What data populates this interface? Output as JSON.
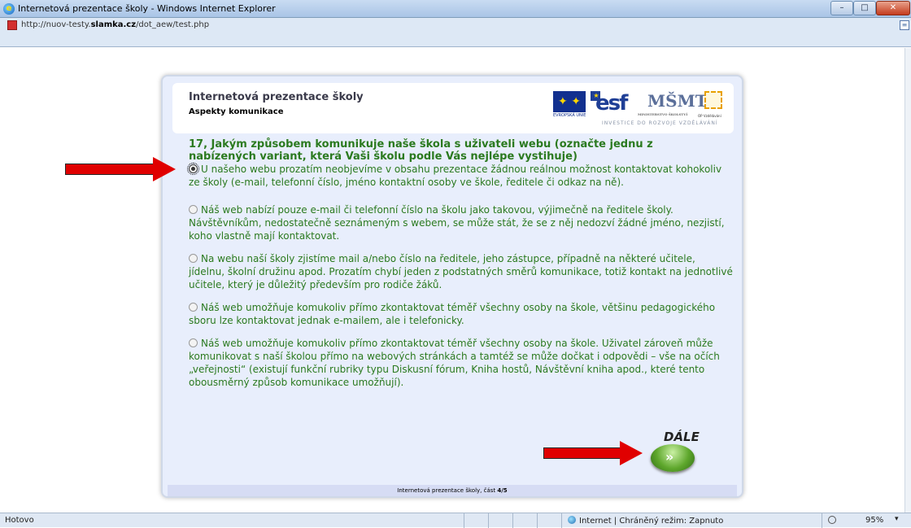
{
  "window": {
    "title": "Internetová prezentace školy - Windows Internet Explorer",
    "minimize": "–",
    "maximize": "□",
    "close": "✕"
  },
  "address": {
    "url_prefix": "http://nuov-testy.",
    "url_domain": "slamka.cz",
    "url_path": "/dot_aew/test.php"
  },
  "page": {
    "title": "Internetová prezentace školy",
    "subtitle": "Aspekty komunikace",
    "logo_tagline": "INVESTICE DO ROZVOJE VZDĚLÁVÁNÍ",
    "logo_eu_caption": "EVROPSKÁ UNIE",
    "logo_msmt": "MŠMT",
    "logo_msmt_caption": "MINISTERSTVO ŠKOLSTVÍ",
    "logo_op_caption": "OP Vzdělávání",
    "question": "17, Jakým způsobem komunikuje naše škola s uživateli webu (označte jednu z nabízených variant, která Vaši školu podle Vás nejlépe vystihuje)",
    "options": [
      {
        "label": "U našeho webu prozatím neobjevíme v obsahu prezentace žádnou reálnou možnost kontaktovat kohokoliv ze školy (e-mail, telefonní číslo, jméno kontaktní osoby ve škole, ředitele či odkaz na ně).",
        "selected": true
      },
      {
        "label": "Náš web nabízí pouze e-mail či telefonní číslo na školu jako takovou, výjimečně na ředitele školy. Návštěvníkům, nedostatečně seznámeným s webem, se může stát, že se z něj nedozví žádné jméno, nezjistí, koho vlastně mají kontaktovat.",
        "selected": false
      },
      {
        "label": "Na webu naší školy zjistíme mail a/nebo číslo na ředitele, jeho zástupce, případně na některé učitele, jídelnu, školní družinu apod. Prozatím chybí jeden z podstatných směrů komunikace, totiž kontakt na jednotlivé učitele, který je důležitý především pro rodiče žáků.",
        "selected": false
      },
      {
        "label": "Náš web umožňuje komukoliv přímo zkontaktovat téměř všechny osoby na škole, většinu pedagogického sboru lze kontaktovat jednak e-mailem, ale i telefonicky.",
        "selected": false
      },
      {
        "label": "Náš web umožňuje komukoliv přímo zkontaktovat téměř všechny osoby na škole. Uživatel zároveň může komunikovat s naší školou přímo na webových stránkách a tamtéž se může dočkat i odpovědi – vše na očích „veřejnosti“ (existují funkční rubriky typu Diskusní fórum, Kniha hostů, Návštěvní kniha apod., které tento obousměrný způsob komunikace umožňují).",
        "selected": false
      }
    ],
    "next_label": "DÁLE",
    "footer_text": "Internetová prezentace školy, část ",
    "footer_part": "4/5"
  },
  "status": {
    "text": "Hotovo",
    "zone": "Internet | Chráněný režim: Zapnuto",
    "zoom": "95%"
  },
  "colors": {
    "question_green": "#2b7a1f",
    "arrow_red": "#e00000",
    "card_bg": "#e8eefc"
  }
}
